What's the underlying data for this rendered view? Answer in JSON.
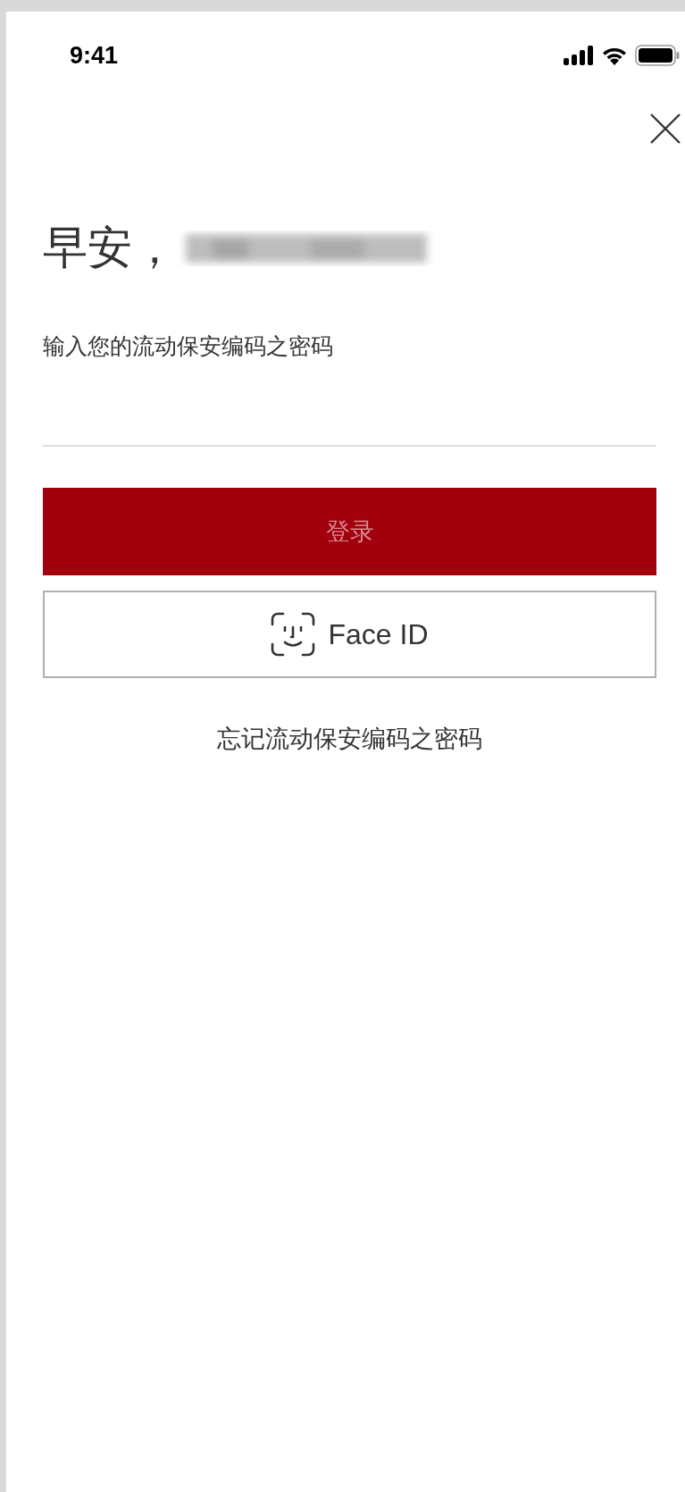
{
  "status_bar": {
    "time": "9:41"
  },
  "greeting": {
    "text": "早安，"
  },
  "password": {
    "label": "输入您的流动保安编码之密码"
  },
  "login_button": {
    "label": "登录",
    "disabled": true
  },
  "face_id_button": {
    "label": "Face ID"
  },
  "forgot_link": {
    "label": "忘记流动保安编码之密码"
  }
}
